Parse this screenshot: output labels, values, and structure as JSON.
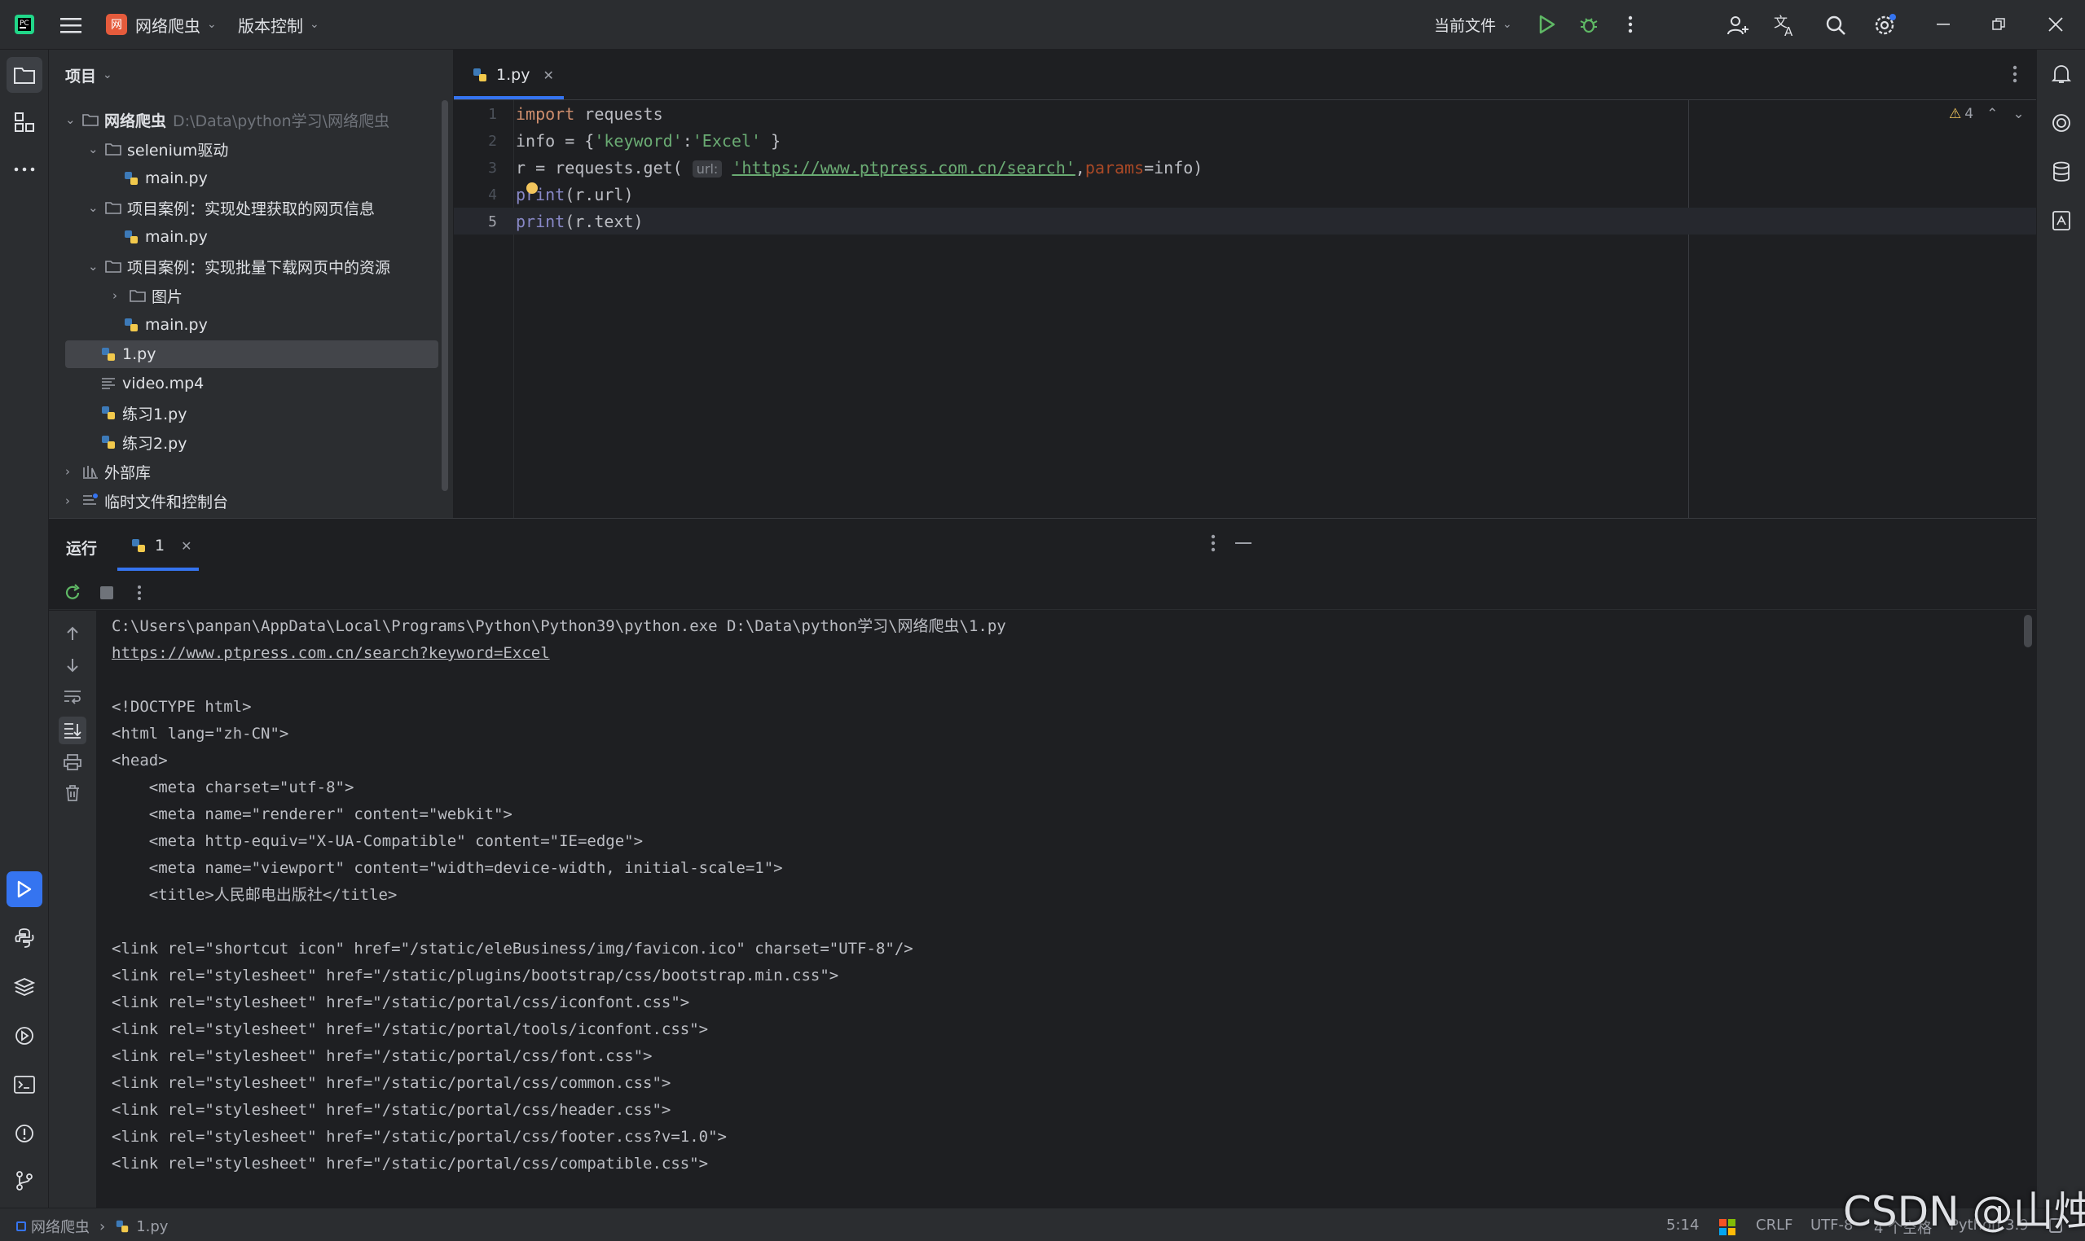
{
  "titlebar": {
    "project_initial": "网",
    "project_name": "网络爬虫",
    "vcs_label": "版本控制",
    "run_config": "当前文件"
  },
  "project_panel": {
    "title": "项目",
    "tree": [
      {
        "label": "网络爬虫",
        "path": "D:\\Data\\python学习\\网络爬虫"
      },
      {
        "label": "selenium驱动"
      },
      {
        "label": "main.py"
      },
      {
        "label": "项目案例：实现处理获取的网页信息"
      },
      {
        "label": "main.py"
      },
      {
        "label": "项目案例：实现批量下载网页中的资源"
      },
      {
        "label": "图片"
      },
      {
        "label": "main.py"
      },
      {
        "label": "1.py"
      },
      {
        "label": "video.mp4"
      },
      {
        "label": "练习1.py"
      },
      {
        "label": "练习2.py"
      },
      {
        "label": "外部库"
      },
      {
        "label": "临时文件和控制台"
      }
    ]
  },
  "editor": {
    "tab": "1.py",
    "warnings": "4",
    "line_numbers": [
      "1",
      "2",
      "3",
      "4",
      "5"
    ],
    "code": {
      "l1_kw": "import",
      "l1_rest": " requests",
      "l2_a": "info = {",
      "l2_s1": "'keyword'",
      "l2_colon": ":",
      "l2_s2": "'Excel'",
      "l2_end": " }",
      "l3_a": "r = requests.get( ",
      "l3_hint": "url:",
      "l3_url": "'https://www.ptpress.com.cn/search'",
      "l3_comma": ",",
      "l3_param": "params",
      "l3_end": "=info)",
      "l4_fn": "print",
      "l4_rest": "(r.url)",
      "l5_fn": "print",
      "l5_rest": "(r.text)"
    }
  },
  "run_panel": {
    "title": "运行",
    "tab": "1",
    "output": [
      "C:\\Users\\panpan\\AppData\\Local\\Programs\\Python\\Python39\\python.exe D:\\Data\\python学习\\网络爬虫\\1.py",
      "https://www.ptpress.com.cn/search?keyword=Excel",
      "",
      "<!DOCTYPE html>",
      "<html lang=\"zh-CN\">",
      "<head>",
      "    <meta charset=\"utf-8\">",
      "    <meta name=\"renderer\" content=\"webkit\">",
      "    <meta http-equiv=\"X-UA-Compatible\" content=\"IE=edge\">",
      "    <meta name=\"viewport\" content=\"width=device-width, initial-scale=1\">",
      "    <title>人民邮电出版社</title>",
      "",
      "<link rel=\"shortcut icon\" href=\"/static/eleBusiness/img/favicon.ico\" charset=\"UTF-8\"/>",
      "<link rel=\"stylesheet\" href=\"/static/plugins/bootstrap/css/bootstrap.min.css\">",
      "<link rel=\"stylesheet\" href=\"/static/portal/css/iconfont.css\">",
      "<link rel=\"stylesheet\" href=\"/static/portal/tools/iconfont.css\">",
      "<link rel=\"stylesheet\" href=\"/static/portal/css/font.css\">",
      "<link rel=\"stylesheet\" href=\"/static/portal/css/common.css\">",
      "<link rel=\"stylesheet\" href=\"/static/portal/css/header.css\">",
      "<link rel=\"stylesheet\" href=\"/static/portal/css/footer.css?v=1.0\">",
      "<link rel=\"stylesheet\" href=\"/static/portal/css/compatible.css\">"
    ]
  },
  "statusbar": {
    "crumb_project": "网络爬虫",
    "crumb_file": "1.py",
    "position": "5:14",
    "line_sep": "CRLF",
    "encoding": "UTF-8",
    "indent": "4 个空格",
    "interpreter": "Python 3.9"
  },
  "watermark": "CSDN @山烛",
  "colors": {
    "accent": "#3574f0",
    "bg": "#1e1f22",
    "panel": "#2b2d30"
  }
}
